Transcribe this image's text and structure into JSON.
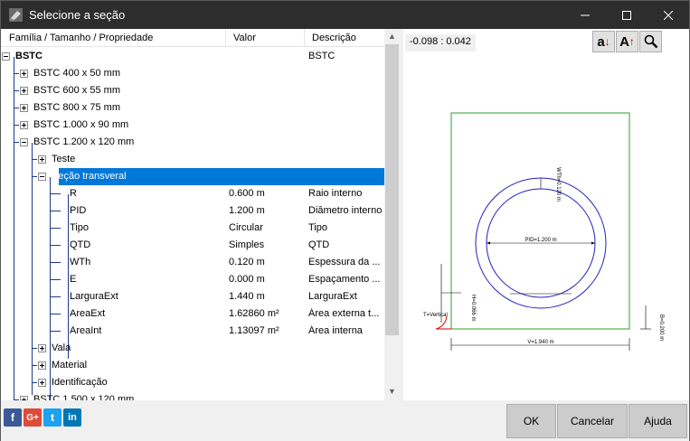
{
  "window": {
    "title": "Selecione a seção"
  },
  "tree": {
    "columns": {
      "name": "Família / Tamanho / Propriedade",
      "value": "Valor",
      "description": "Descrição"
    },
    "rows": [
      {
        "label": "BSTC",
        "value": "",
        "desc": "BSTC",
        "bold": true,
        "expander": "minus",
        "level": 0
      },
      {
        "label": "BSTC 400 x 50 mm",
        "value": "",
        "desc": "",
        "expander": "plus",
        "level": 1
      },
      {
        "label": "BSTC 600 x 55 mm",
        "value": "",
        "desc": "",
        "expander": "plus",
        "level": 1
      },
      {
        "label": "BSTC 800 x 75 mm",
        "value": "",
        "desc": "",
        "expander": "plus",
        "level": 1
      },
      {
        "label": "BSTC 1.000 x 90 mm",
        "value": "",
        "desc": "",
        "expander": "plus",
        "level": 1
      },
      {
        "label": "BSTC 1.200 x 120 mm",
        "value": "",
        "desc": "",
        "expander": "minus",
        "level": 1
      },
      {
        "label": "Teste",
        "value": "",
        "desc": "",
        "expander": "plus",
        "level": 2
      },
      {
        "label": "Seção transveral",
        "value": "",
        "desc": "",
        "expander": "minus",
        "level": 2,
        "selected": true
      },
      {
        "label": "R",
        "value": "0.600 m",
        "desc": "Raio interno",
        "level": 3
      },
      {
        "label": "PID",
        "value": "1.200 m",
        "desc": "Diâmetro interno",
        "level": 3
      },
      {
        "label": "Tipo",
        "value": "Circular",
        "desc": "Tipo",
        "level": 3
      },
      {
        "label": "QTD",
        "value": "Simples",
        "desc": "QTD",
        "level": 3
      },
      {
        "label": "WTh",
        "value": "0.120 m",
        "desc": "Espessura da ...",
        "level": 3
      },
      {
        "label": "E",
        "value": "0.000 m",
        "desc": "Espaçamento ...",
        "level": 3
      },
      {
        "label": "LarguraExt",
        "value": "1.440 m",
        "desc": "LarguraExt",
        "level": 3
      },
      {
        "label": "AreaExt",
        "value": "1.62860 m²",
        "desc": "Área externa t...",
        "level": 3
      },
      {
        "label": "AreaInt",
        "value": "1.13097 m²",
        "desc": "Área interna",
        "level": 3
      },
      {
        "label": "Vala",
        "value": "",
        "desc": "",
        "expander": "plus",
        "level": 2
      },
      {
        "label": "Material",
        "value": "",
        "desc": "",
        "expander": "plus",
        "level": 2
      },
      {
        "label": "Identificação",
        "value": "",
        "desc": "",
        "expander": "plus",
        "level": 2
      },
      {
        "label": "BSTC 1.500 x 120 mm",
        "value": "",
        "desc": "",
        "expander": "plus",
        "level": 1
      }
    ]
  },
  "preview": {
    "coordinates": "-0.098 : 0.042",
    "tools": {
      "sort_asc": "a",
      "font_size": "A",
      "zoom": "zoom"
    },
    "labels": {
      "pid": "PID=1.200 m",
      "wth": "WTh=0.120 m",
      "v": "V=1.940 m",
      "b": "B=0.200 m",
      "t": "T=Vertical",
      "h": "H=0.066 m"
    }
  },
  "social": [
    "f",
    "G+",
    "t",
    "in"
  ],
  "buttons": {
    "ok": "OK",
    "cancel": "Cancelar",
    "help": "Ajuda"
  },
  "colors": {
    "selection": "#0078d7",
    "title_bar": "#2d2d2d",
    "pipe": "#2020c0",
    "trench": "#2e9e2e"
  }
}
